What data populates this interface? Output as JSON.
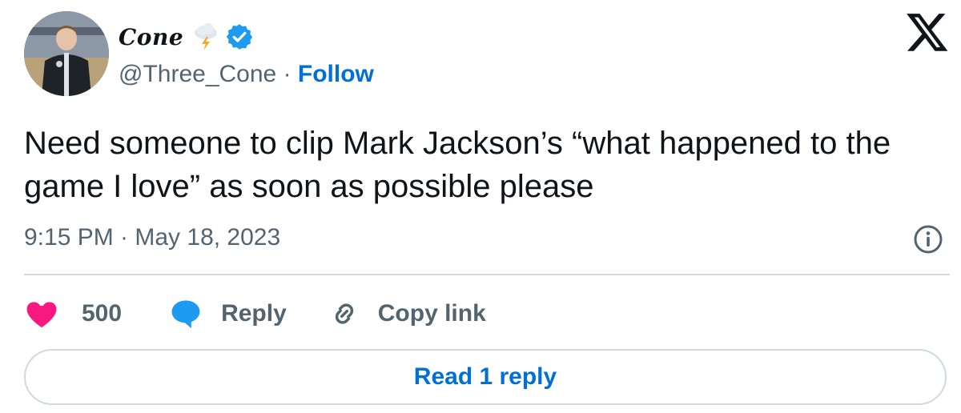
{
  "author": {
    "display_name": "Cone",
    "handle": "@Three_Cone",
    "separator": " · ",
    "follow_label": "Follow"
  },
  "tweet": {
    "text": "Need someone to clip Mark Jackson’s “what happened to the game I love” as soon as possible please",
    "timestamp": "9:15 PM · May 18, 2023"
  },
  "actions": {
    "like_count": "500",
    "reply_label": "Reply",
    "copy_link_label": "Copy link"
  },
  "read_replies_label": "Read 1 reply",
  "icons": {
    "emoji": "cloud-lightning-icon",
    "verified": "verified-badge-icon",
    "brand": "x-logo-icon",
    "info": "info-icon",
    "like": "heart-icon",
    "reply": "speech-bubble-icon",
    "copy": "link-icon"
  },
  "colors": {
    "like": "#f91880",
    "reply": "#1d9bf0",
    "link_blue": "#006fd6",
    "verified": "#1d9bf0",
    "muted_text": "#536471",
    "divider": "#cfd9de"
  }
}
